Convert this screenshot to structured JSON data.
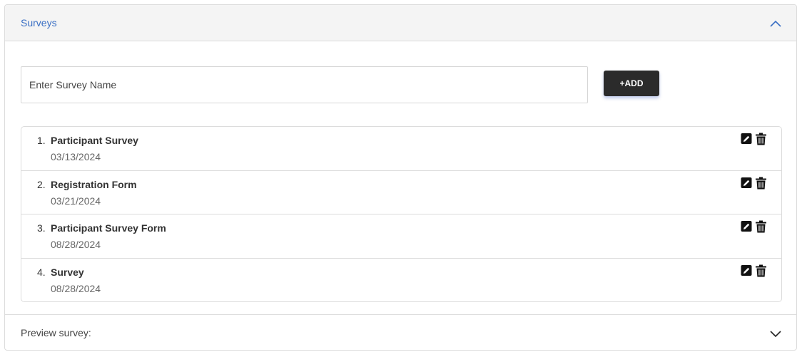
{
  "panel": {
    "title": "Surveys"
  },
  "form": {
    "input_placeholder": "Enter Survey Name",
    "input_value": "",
    "add_label": "+ADD"
  },
  "surveys": [
    {
      "num": "1.",
      "name": "Participant Survey",
      "date": "03/13/2024"
    },
    {
      "num": "2.",
      "name": "Registration Form",
      "date": "03/21/2024"
    },
    {
      "num": "3.",
      "name": "Participant Survey Form",
      "date": "08/28/2024"
    },
    {
      "num": "4.",
      "name": "Survey",
      "date": "08/28/2024"
    }
  ],
  "preview": {
    "label": "Preview survey:"
  },
  "colors": {
    "title_blue": "#3a6fc4",
    "button_dark": "#2b2b2b",
    "header_bg": "#f4f4f4"
  },
  "icons": {
    "collapse": "chevron-up-icon",
    "expand": "chevron-down-icon",
    "edit": "pencil-square-icon",
    "delete": "trash-icon"
  }
}
